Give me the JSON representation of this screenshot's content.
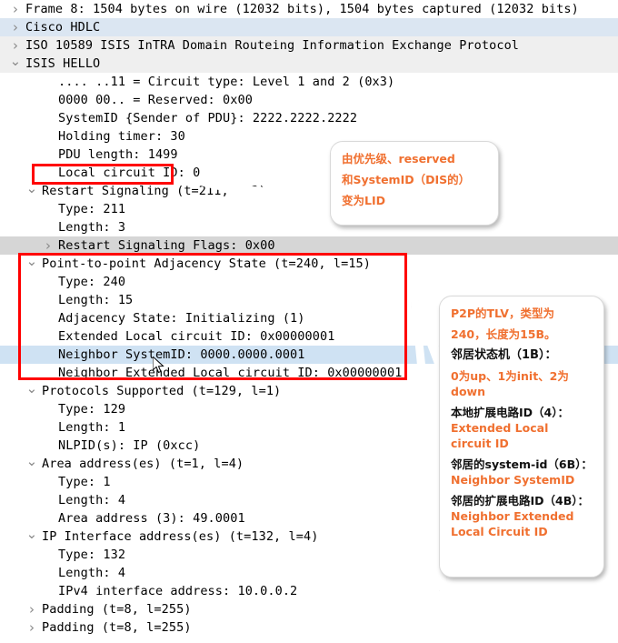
{
  "app": {
    "name": "wireshark-packet-details",
    "accent_red": "#ff0000",
    "accent_orange": "#f07030",
    "selection_blue": "#cfe2f3"
  },
  "tree": {
    "rows": [
      {
        "indent": 0,
        "twisty": "closed",
        "text": "Frame 8: 1504 bytes on wire (12032 bits), 1504 bytes captured (12032 bits)",
        "bg": "white"
      },
      {
        "indent": 0,
        "twisty": "closed",
        "text": "Cisco HDLC",
        "bg": "blue"
      },
      {
        "indent": 0,
        "twisty": "closed",
        "text": "ISO 10589 ISIS InTRA Domain Routeing Information Exchange Protocol",
        "bg": "gray"
      },
      {
        "indent": 0,
        "twisty": "open",
        "text": "ISIS HELLO",
        "bg": "gray"
      },
      {
        "indent": 2,
        "twisty": "none",
        "text": ".... ..11 = Circuit type: Level 1 and 2 (0x3)",
        "bg": "white"
      },
      {
        "indent": 2,
        "twisty": "none",
        "text": "0000 00.. = Reserved: 0x00",
        "bg": "white"
      },
      {
        "indent": 2,
        "twisty": "none",
        "text": "SystemID {Sender of PDU}: 2222.2222.2222",
        "bg": "white"
      },
      {
        "indent": 2,
        "twisty": "none",
        "text": "Holding timer: 30",
        "bg": "white"
      },
      {
        "indent": 2,
        "twisty": "none",
        "text": "PDU length: 1499",
        "bg": "white"
      },
      {
        "indent": 2,
        "twisty": "none",
        "text": "Local circuit ID: 0",
        "bg": "white"
      },
      {
        "indent": 1,
        "twisty": "open",
        "text": "Restart Signaling (t=211, l=3)",
        "bg": "white"
      },
      {
        "indent": 2,
        "twisty": "none",
        "text": "Type: 211",
        "bg": "white"
      },
      {
        "indent": 2,
        "twisty": "none",
        "text": "Length: 3",
        "bg": "white"
      },
      {
        "indent": 2,
        "twisty": "closed",
        "text": "Restart Signaling Flags: 0x00",
        "bg": "gray2"
      },
      {
        "indent": 1,
        "twisty": "open",
        "text": "Point-to-point Adjacency State (t=240, l=15)",
        "bg": "white"
      },
      {
        "indent": 2,
        "twisty": "none",
        "text": "Type: 240",
        "bg": "white"
      },
      {
        "indent": 2,
        "twisty": "none",
        "text": "Length: 15",
        "bg": "white"
      },
      {
        "indent": 2,
        "twisty": "none",
        "text": "Adjacency State: Initializing (1)",
        "bg": "white"
      },
      {
        "indent": 2,
        "twisty": "none",
        "text": "Extended Local circuit ID: 0x00000001",
        "bg": "white"
      },
      {
        "indent": 2,
        "twisty": "none",
        "text": "Neighbor SystemID: 0000.0000.0001",
        "bg": "sel"
      },
      {
        "indent": 2,
        "twisty": "none",
        "text": "Neighbor Extended Local circuit ID: 0x00000001",
        "bg": "white"
      },
      {
        "indent": 1,
        "twisty": "open",
        "text": "Protocols Supported (t=129, l=1)",
        "bg": "white"
      },
      {
        "indent": 2,
        "twisty": "none",
        "text": "Type: 129",
        "bg": "white"
      },
      {
        "indent": 2,
        "twisty": "none",
        "text": "Length: 1",
        "bg": "white"
      },
      {
        "indent": 2,
        "twisty": "none",
        "text": "NLPID(s): IP (0xcc)",
        "bg": "white"
      },
      {
        "indent": 1,
        "twisty": "open",
        "text": "Area address(es) (t=1, l=4)",
        "bg": "white"
      },
      {
        "indent": 2,
        "twisty": "none",
        "text": "Type: 1",
        "bg": "white"
      },
      {
        "indent": 2,
        "twisty": "none",
        "text": "Length: 4",
        "bg": "white"
      },
      {
        "indent": 2,
        "twisty": "none",
        "text": "Area address (3): 49.0001",
        "bg": "white"
      },
      {
        "indent": 1,
        "twisty": "open",
        "text": "IP Interface address(es) (t=132, l=4)",
        "bg": "white"
      },
      {
        "indent": 2,
        "twisty": "none",
        "text": "Type: 132",
        "bg": "white"
      },
      {
        "indent": 2,
        "twisty": "none",
        "text": "Length: 4",
        "bg": "white"
      },
      {
        "indent": 2,
        "twisty": "none",
        "text": "IPv4 interface address: 10.0.0.2",
        "bg": "white"
      },
      {
        "indent": 1,
        "twisty": "closed",
        "text": "Padding (t=8, l=255)",
        "bg": "white"
      },
      {
        "indent": 1,
        "twisty": "closed",
        "text": "Padding (t=8, l=255)",
        "bg": "white"
      }
    ]
  },
  "annotations": {
    "highlight_boxes": [
      {
        "name": "local-circuit-id-box"
      },
      {
        "name": "p2p-adjacency-state-box"
      }
    ],
    "callout_1": {
      "line1": "由优先级、reserved",
      "line2": "和SystemID（DIS的）",
      "line3": "变为LID"
    },
    "callout_2": {
      "p1_line1": "P2P的TLV，类型为",
      "p1_line2": "240，长度为15B。",
      "p2_head": "邻居状态机（1B）：",
      "p2_body": "0为up、1为init、2为down",
      "p3_head": "本地扩展电路ID（4）：",
      "p3_value": "Extended Local circuit ID",
      "p4_head": "邻居的system-id（6B）：",
      "p4_value": "Neighbor SystemID",
      "p5_head": "邻居的扩展电路ID（4B）：",
      "p5_value": "Neighbor Extended Local Circuit ID"
    }
  }
}
